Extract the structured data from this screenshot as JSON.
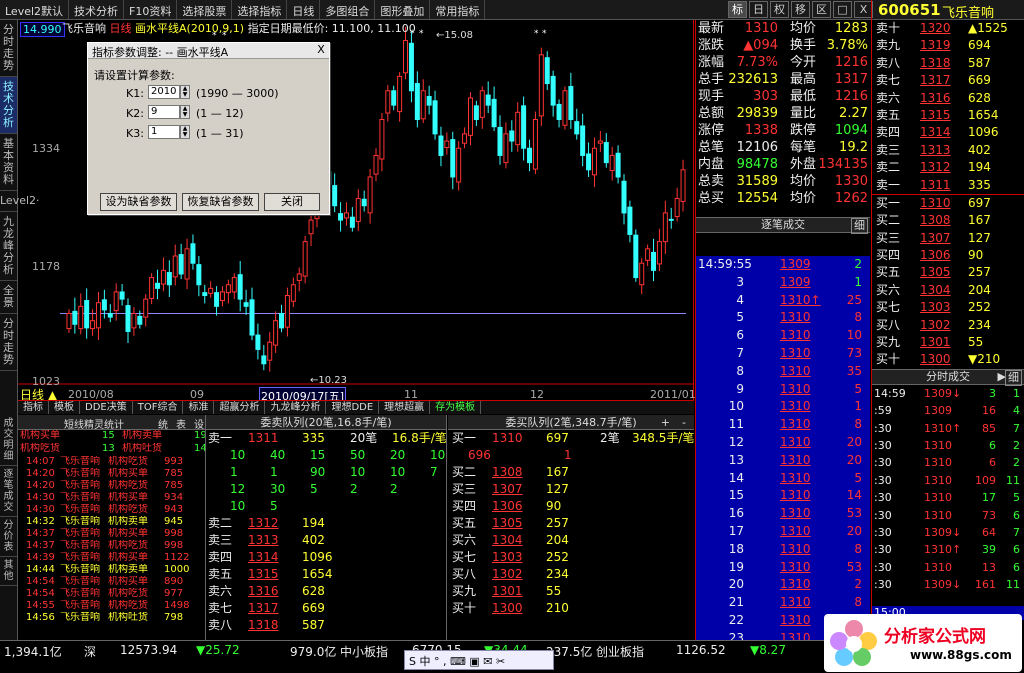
{
  "toolbar": {
    "menus": [
      "Level2默认",
      "技术分析",
      "F10资料",
      "选择股票",
      "选择指标",
      "日线",
      "多图组合",
      "图形叠加",
      "常用指标"
    ],
    "right_buttons": [
      "标",
      "日",
      "权",
      "移",
      "区",
      "□",
      "X"
    ]
  },
  "left_tabs": [
    "分时走势",
    "技术分析",
    "基本资料",
    "Level2·",
    "九龙峰分析",
    "全景",
    "分时走势"
  ],
  "left_tabs_bottom": [
    "成交明细",
    "逐笔成交",
    "分价表",
    "其他"
  ],
  "chart": {
    "stock_name": "飞乐音响",
    "period": "日线",
    "indicator": "画水平线A(2010,9,1)",
    "indicator_note": "指定日期最低价: 11.100, 11.100",
    "y_labels": [
      "14.990",
      "1334",
      "1178",
      "1023"
    ],
    "x_labels": [
      "2010/08",
      "09",
      "2010/09/17[五]",
      "11",
      "12",
      "2011/01"
    ],
    "low_mark": "10.23",
    "high_mark": "15.08",
    "period_label": "日线"
  },
  "dialog": {
    "title": "指标参数调整: -- 画水平线A",
    "prompt": "请设置计算参数:",
    "params": [
      {
        "label": "K1:",
        "value": "2010",
        "range": "(1990 — 3000)"
      },
      {
        "label": "K2:",
        "value": "9",
        "range": "(1 — 12)"
      },
      {
        "label": "K3:",
        "value": "1",
        "range": "(1 — 31)"
      }
    ],
    "buttons": [
      "设为缺省参数",
      "恢复缺省参数",
      "关闭"
    ],
    "close_icon": "X"
  },
  "bottom_tabs": [
    "指标",
    "模板",
    "DDE决策",
    "TOF综合",
    "标准",
    "超赢分析",
    "九龙峰分析",
    "理想DDE",
    "理想超赢",
    "存为模板"
  ],
  "jl": {
    "title": "短线精灵统计",
    "tabs": [
      "统",
      "表",
      "设"
    ],
    "stats": [
      [
        "机构买单",
        "15",
        "机构卖单",
        "19"
      ],
      [
        "机构吃货",
        "13",
        "机构吐货",
        "14"
      ]
    ],
    "rows": [
      [
        "14:07",
        "飞乐音响",
        "机构吃货",
        "993"
      ],
      [
        "14:20",
        "飞乐音响",
        "机构买单",
        "785"
      ],
      [
        "14:20",
        "飞乐音响",
        "机构吃货",
        "785"
      ],
      [
        "14:30",
        "飞乐音响",
        "机构买单",
        "934"
      ],
      [
        "14:30",
        "飞乐音响",
        "机构吃货",
        "943"
      ],
      [
        "14:32",
        "飞乐音响",
        "机构卖单",
        "945"
      ],
      [
        "14:37",
        "飞乐音响",
        "机构买单",
        "998"
      ],
      [
        "14:37",
        "飞乐音响",
        "机构吃货",
        "998"
      ],
      [
        "14:39",
        "飞乐音响",
        "机构买单",
        "1122"
      ],
      [
        "14:44",
        "飞乐音响",
        "机构卖单",
        "1000"
      ],
      [
        "14:54",
        "飞乐音响",
        "机构买单",
        "890"
      ],
      [
        "14:54",
        "飞乐音响",
        "机构吃货",
        "977"
      ],
      [
        "14:55",
        "飞乐音响",
        "机构吃货",
        "1498"
      ],
      [
        "14:56",
        "飞乐音响",
        "机构吐货",
        "798"
      ]
    ]
  },
  "sellq": {
    "title": "委卖队列(20笔,16.8手/笔)",
    "first": {
      "label": "卖一",
      "price": "1311",
      "vol": "335",
      "n": "20笔",
      "avg": "16.8手/笔"
    },
    "grid": [
      [
        "10",
        "40",
        "15",
        "50",
        "20",
        "10"
      ],
      [
        "1",
        "1",
        "90",
        "10",
        "10",
        "7"
      ],
      [
        "12",
        "30",
        "5",
        "2",
        "2",
        ""
      ],
      [
        "10",
        "5",
        "",
        "",
        "",
        ""
      ]
    ],
    "rows": [
      [
        "卖二",
        "1312",
        "194"
      ],
      [
        "卖三",
        "1313",
        "402"
      ],
      [
        "卖四",
        "1314",
        "1096"
      ],
      [
        "卖五",
        "1315",
        "1654"
      ],
      [
        "卖六",
        "1316",
        "628"
      ],
      [
        "卖七",
        "1317",
        "669"
      ],
      [
        "卖八",
        "1318",
        "587"
      ]
    ]
  },
  "buyq": {
    "title": "委买队列(2笔,348.7手/笔)",
    "icons": [
      "+",
      "-"
    ],
    "first": {
      "label": "买一",
      "price": "1310",
      "vol": "697",
      "n": "2笔",
      "avg": "348.5手/笔",
      "extra": "696",
      "extra2": "1"
    },
    "rows": [
      [
        "买二",
        "1308",
        "167"
      ],
      [
        "买三",
        "1307",
        "127"
      ],
      [
        "买四",
        "1306",
        "90"
      ],
      [
        "买五",
        "1305",
        "257"
      ],
      [
        "买六",
        "1304",
        "204"
      ],
      [
        "买七",
        "1303",
        "252"
      ],
      [
        "买八",
        "1302",
        "234"
      ],
      [
        "买九",
        "1301",
        "55"
      ],
      [
        "买十",
        "1300",
        "210"
      ]
    ]
  },
  "quote": {
    "rows": [
      [
        "最新",
        "1310",
        "均价",
        "1283"
      ],
      [
        "涨跌",
        "▲094",
        "换手",
        "3.78%"
      ],
      [
        "涨幅",
        "7.73%",
        "今开",
        "1216"
      ],
      [
        "总手",
        "232613",
        "最高",
        "1317"
      ],
      [
        "现手",
        "303",
        "最低",
        "1216"
      ],
      [
        "总额",
        "29839",
        "量比",
        "2.27"
      ],
      [
        "涨停",
        "1338",
        "跌停",
        "1094"
      ],
      [
        "总笔",
        "12106",
        "每笔",
        "19.2"
      ],
      [
        "内盘",
        "98478",
        "外盘",
        "134135"
      ],
      [
        "总卖",
        "31589",
        "均价",
        "1330"
      ],
      [
        "总买",
        "12554",
        "均价",
        "1262"
      ]
    ],
    "ticks_title": "逐笔成交",
    "ticks_btn": "细",
    "ticks": [
      [
        "14:59:55",
        "1309",
        "2"
      ],
      [
        "3",
        "1309",
        "1"
      ],
      [
        "4",
        "1310↑",
        "25"
      ],
      [
        "5",
        "1310",
        "8"
      ],
      [
        "6",
        "1310",
        "10"
      ],
      [
        "7",
        "1310",
        "73"
      ],
      [
        "8",
        "1310",
        "35"
      ],
      [
        "9",
        "1310",
        "5"
      ],
      [
        "10",
        "1310",
        "1"
      ],
      [
        "11",
        "1310",
        "8"
      ],
      [
        "12",
        "1310",
        "20"
      ],
      [
        "13",
        "1310",
        "20"
      ],
      [
        "14",
        "1310",
        "5"
      ],
      [
        "15",
        "1310",
        "14"
      ],
      [
        "16",
        "1310",
        "53"
      ],
      [
        "17",
        "1310",
        "20"
      ],
      [
        "18",
        "1310",
        "8"
      ],
      [
        "19",
        "1310",
        "53"
      ],
      [
        "20",
        "1310",
        "2"
      ],
      [
        "21",
        "1310",
        "8"
      ],
      [
        "22",
        "1310",
        "8"
      ],
      [
        "23",
        "1310",
        "17"
      ]
    ]
  },
  "far": {
    "code": "600651",
    "name": "飞乐音响",
    "sells": [
      [
        "卖十",
        "1320",
        "▲1525"
      ],
      [
        "卖九",
        "1319",
        "694"
      ],
      [
        "卖八",
        "1318",
        "587"
      ],
      [
        "卖七",
        "1317",
        "669"
      ],
      [
        "卖六",
        "1316",
        "628"
      ],
      [
        "卖五",
        "1315",
        "1654"
      ],
      [
        "卖四",
        "1314",
        "1096"
      ],
      [
        "卖三",
        "1313",
        "402"
      ],
      [
        "卖二",
        "1312",
        "194"
      ],
      [
        "卖一",
        "1311",
        "335"
      ]
    ],
    "buys": [
      [
        "买一",
        "1310",
        "697"
      ],
      [
        "买二",
        "1308",
        "167"
      ],
      [
        "买三",
        "1307",
        "127"
      ],
      [
        "买四",
        "1306",
        "90"
      ],
      [
        "买五",
        "1305",
        "257"
      ],
      [
        "买六",
        "1304",
        "204"
      ],
      [
        "买七",
        "1303",
        "252"
      ],
      [
        "买八",
        "1302",
        "234"
      ],
      [
        "买九",
        "1301",
        "55"
      ],
      [
        "买十",
        "1300",
        "▼210"
      ]
    ],
    "fs_title": "分时成交",
    "fs_btn": "细",
    "fs": [
      [
        "14:59",
        "1309↓",
        "3",
        "1"
      ],
      [
        ":59",
        "1309",
        "16",
        "4"
      ],
      [
        ":30",
        "1310↑",
        "85",
        "7"
      ],
      [
        ":30",
        "1310",
        "6",
        "2"
      ],
      [
        ":30",
        "1310",
        "6",
        "2"
      ],
      [
        ":30",
        "1310",
        "109",
        "11"
      ],
      [
        ":30",
        "1310",
        "17",
        "5"
      ],
      [
        ":30",
        "1310",
        "73",
        "6"
      ],
      [
        ":30",
        "1309↓",
        "64",
        "7"
      ],
      [
        ":30",
        "1310↑",
        "39",
        "6"
      ],
      [
        ":30",
        "1310",
        "13",
        "6"
      ],
      [
        ":30",
        "1309↓",
        "161",
        "11"
      ]
    ],
    "last_time": "15:00"
  },
  "status": {
    "items": [
      "1,394.1亿",
      "深",
      "12573.94",
      "▼25.72",
      "979.0亿",
      "中小板指",
      "6770.15",
      "▼34.44",
      "237.5亿",
      "创业板指",
      "1126.52",
      "▼8.27"
    ],
    "watermark": "分析家公式网",
    "watermark_url": "www.88gs.com"
  }
}
